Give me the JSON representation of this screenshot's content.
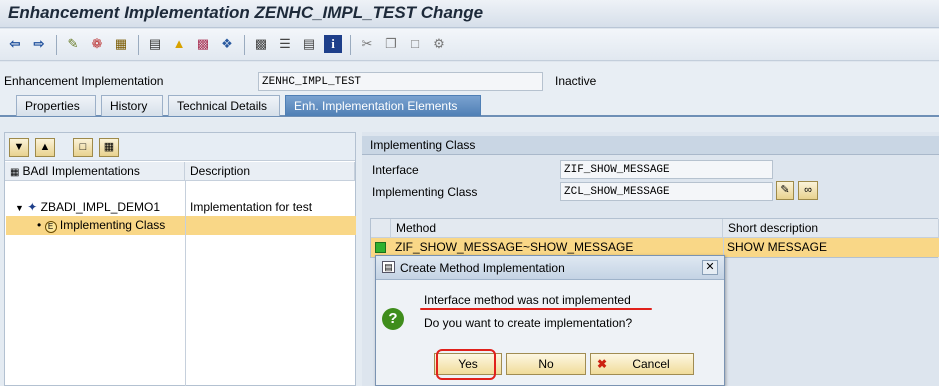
{
  "window": {
    "title": "Enhancement Implementation ZENHC_IMPL_TEST Change"
  },
  "header": {
    "enh_impl_label": "Enhancement Implementation",
    "enh_impl_value": "ZENHC_IMPL_TEST",
    "status": "Inactive"
  },
  "tabs": [
    {
      "label": "Properties"
    },
    {
      "label": "History"
    },
    {
      "label": "Technical Details"
    },
    {
      "label": "Enh. Implementation Elements"
    }
  ],
  "left_panel": {
    "col_badi": "BAdI Implementations",
    "col_desc": "Description",
    "tree": [
      {
        "label": "ZBADI_IMPL_DEMO1",
        "description": "Implementation for test"
      },
      {
        "label": "Implementing Class",
        "description": ""
      }
    ]
  },
  "right_panel": {
    "section_title": "Implementing Class",
    "interface_label": "Interface",
    "interface_value": "ZIF_SHOW_MESSAGE",
    "impl_class_label": "Implementing Class",
    "impl_class_value": "ZCL_SHOW_MESSAGE",
    "grid": {
      "col_method": "Method",
      "col_short": "Short description",
      "rows": [
        {
          "method": "ZIF_SHOW_MESSAGE~SHOW_MESSAGE",
          "short": "SHOW MESSAGE"
        }
      ]
    }
  },
  "dialog": {
    "title": "Create Method Implementation",
    "line1": "Interface method was not implemented",
    "line2": "Do you want to create implementation?",
    "yes": "Yes",
    "no": "No",
    "cancel": "Cancel"
  }
}
